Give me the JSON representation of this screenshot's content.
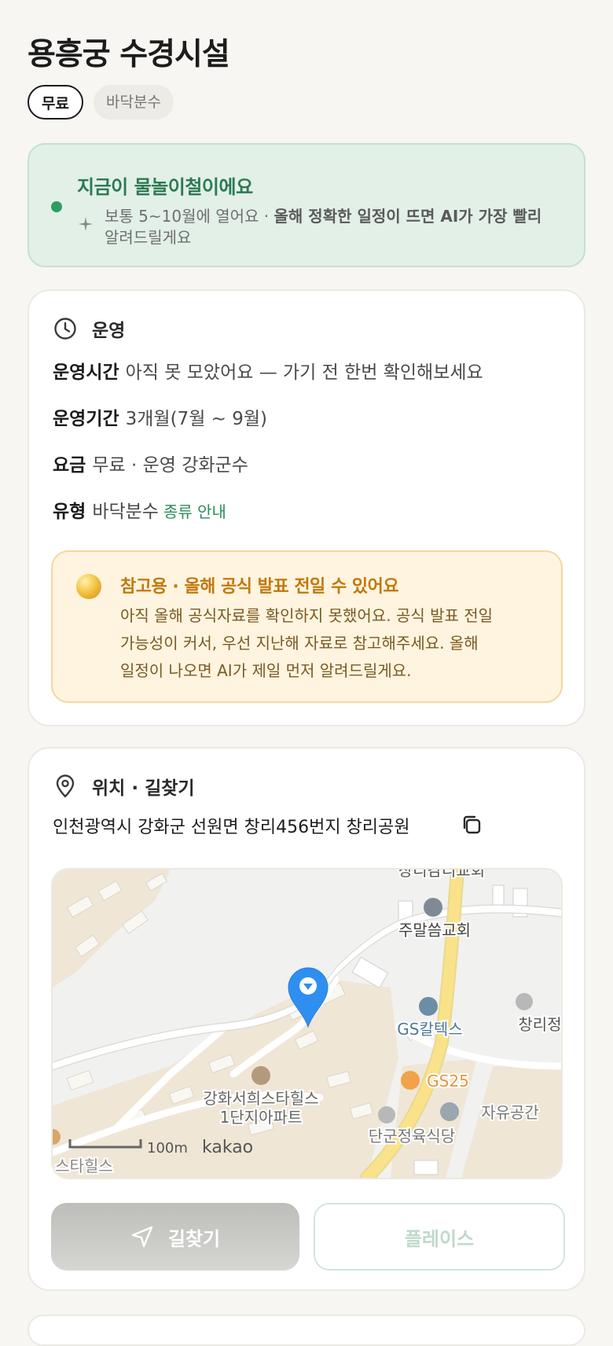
{
  "header": {
    "title": "용흥궁 수경시설"
  },
  "chips": [
    {
      "label": "무료"
    },
    {
      "label": "바닥분수"
    }
  ],
  "season": {
    "title": "지금이 물놀이철이에요",
    "desc_prefix": "보통 5~10월에 열어요 · ",
    "desc_bold": "올해 정확한 일정이 뜨면 AI가 가장 빨리",
    "desc_suffix": "알려드릴게요",
    "dot_color": "#2f9d62"
  },
  "operation": {
    "heading": "운영",
    "rows": [
      {
        "label": "운영시간",
        "value": "아직 못 모았어요 — 가기 전 한번 확인해보세요"
      },
      {
        "label": "운영기간",
        "value": "3개월(7월 ~ 9월)"
      },
      {
        "label": "요금",
        "value": "무료 · 운영 강화군수"
      },
      {
        "label": "유형",
        "value": "바닥분수",
        "link": "종류 안내"
      }
    ],
    "notice": {
      "title": "참고용 · 올해 공식 발표 전일 수 있어요",
      "lines": [
        "아직 올해 공식자료를 확인하지 못했어요. 공식 발표 전일",
        "가능성이 커서, 우선 지난해 자료로 참고해주세요. 올해",
        "일정이 나오면 AI가 제일 먼저 알려드릴게요."
      ]
    }
  },
  "location": {
    "heading": "위치 · 길찾기",
    "address": "인천광역시 강화군 선원면 창리456번지 창리공원",
    "map": {
      "labels": {
        "church_top": "창리감리교회",
        "church": "주말씀교회",
        "gas": "GS칼텍스",
        "changri": "창리정",
        "gs25": "GS25",
        "apt_line1": "강화서희스타힐스",
        "apt_line2": "1단지아파트",
        "free_space": "자유공간",
        "restaurant": "단군정육식당",
        "star_hills": "스타힐스",
        "scale": "100m",
        "logo": "kakao"
      },
      "marker_color": "#2f8ff0",
      "road_color": "#f7df7f"
    },
    "buttons": {
      "route": "길찾기",
      "place": "플레이스"
    }
  }
}
